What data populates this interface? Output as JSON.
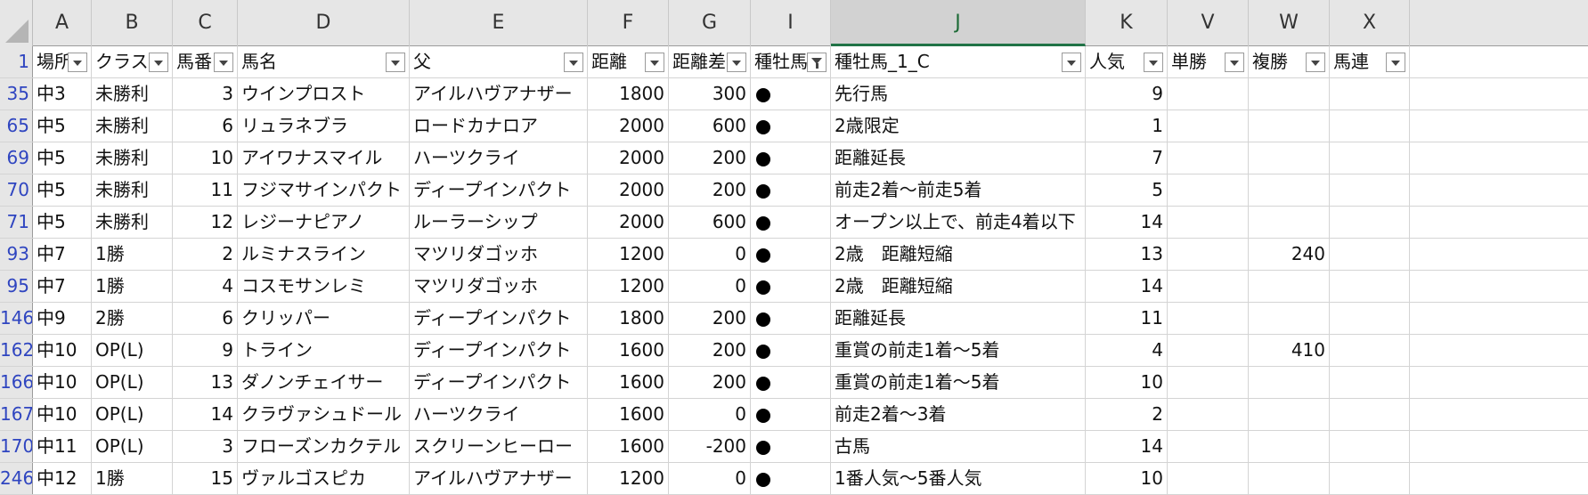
{
  "columns": [
    "A",
    "B",
    "C",
    "D",
    "E",
    "F",
    "G",
    "I",
    "J",
    "K",
    "V",
    "W",
    "X"
  ],
  "headers": [
    "場所",
    "クラス",
    "馬番",
    "馬名",
    "父",
    "距離",
    "距離差",
    "種牡馬_",
    "種牡馬_1_C",
    "人気",
    "単勝",
    "複勝",
    "馬連"
  ],
  "rows": [
    {
      "rownum": "35",
      "place": "中3",
      "cls": "未勝利",
      "umaban": "3",
      "name": "ウインプロスト",
      "sire": "アイルハヴアナザー",
      "dist": "1800",
      "diff": "300",
      "mark": "●",
      "cond": "先行馬",
      "pop": "9",
      "win": "",
      "place_pay": "",
      "quinella": ""
    },
    {
      "rownum": "65",
      "place": "中5",
      "cls": "未勝利",
      "umaban": "6",
      "name": "リュラネブラ",
      "sire": "ロードカナロア",
      "dist": "2000",
      "diff": "600",
      "mark": "●",
      "cond": "2歳限定",
      "pop": "1",
      "win": "",
      "place_pay": "",
      "quinella": ""
    },
    {
      "rownum": "69",
      "place": "中5",
      "cls": "未勝利",
      "umaban": "10",
      "name": "アイワナスマイル",
      "sire": "ハーツクライ",
      "dist": "2000",
      "diff": "200",
      "mark": "●",
      "cond": "距離延長",
      "pop": "7",
      "win": "",
      "place_pay": "",
      "quinella": ""
    },
    {
      "rownum": "70",
      "place": "中5",
      "cls": "未勝利",
      "umaban": "11",
      "name": "フジマサインパクト",
      "sire": "ディープインパクト",
      "dist": "2000",
      "diff": "200",
      "mark": "●",
      "cond": "前走2着～前走5着",
      "pop": "5",
      "win": "",
      "place_pay": "",
      "quinella": ""
    },
    {
      "rownum": "71",
      "place": "中5",
      "cls": "未勝利",
      "umaban": "12",
      "name": "レジーナピアノ",
      "sire": "ルーラーシップ",
      "dist": "2000",
      "diff": "600",
      "mark": "●",
      "cond": "オープン以上で、前走4着以下",
      "pop": "14",
      "win": "",
      "place_pay": "",
      "quinella": ""
    },
    {
      "rownum": "93",
      "place": "中7",
      "cls": "1勝",
      "umaban": "2",
      "name": "ルミナスライン",
      "sire": "マツリダゴッホ",
      "dist": "1200",
      "diff": "0",
      "mark": "●",
      "cond": "2歳　距離短縮",
      "pop": "13",
      "win": "",
      "place_pay": "240",
      "quinella": ""
    },
    {
      "rownum": "95",
      "place": "中7",
      "cls": "1勝",
      "umaban": "4",
      "name": "コスモサンレミ",
      "sire": "マツリダゴッホ",
      "dist": "1200",
      "diff": "0",
      "mark": "●",
      "cond": "2歳　距離短縮",
      "pop": "14",
      "win": "",
      "place_pay": "",
      "quinella": ""
    },
    {
      "rownum": "146",
      "place": "中9",
      "cls": "2勝",
      "umaban": "6",
      "name": "クリッパー",
      "sire": "ディープインパクト",
      "dist": "1800",
      "diff": "200",
      "mark": "●",
      "cond": "距離延長",
      "pop": "11",
      "win": "",
      "place_pay": "",
      "quinella": ""
    },
    {
      "rownum": "162",
      "place": "中10",
      "cls": "OP(L)",
      "umaban": "9",
      "name": "トライン",
      "sire": "ディープインパクト",
      "dist": "1600",
      "diff": "200",
      "mark": "●",
      "cond": "重賞の前走1着～5着",
      "pop": "4",
      "win": "",
      "place_pay": "410",
      "quinella": ""
    },
    {
      "rownum": "166",
      "place": "中10",
      "cls": "OP(L)",
      "umaban": "13",
      "name": "ダノンチェイサー",
      "sire": "ディープインパクト",
      "dist": "1600",
      "diff": "200",
      "mark": "●",
      "cond": "重賞の前走1着～5着",
      "pop": "10",
      "win": "",
      "place_pay": "",
      "quinella": ""
    },
    {
      "rownum": "167",
      "place": "中10",
      "cls": "OP(L)",
      "umaban": "14",
      "name": "クラヴァシュドール",
      "sire": "ハーツクライ",
      "dist": "1600",
      "diff": "0",
      "mark": "●",
      "cond": "前走2着～3着",
      "pop": "2",
      "win": "",
      "place_pay": "",
      "quinella": ""
    },
    {
      "rownum": "170",
      "place": "中11",
      "cls": "OP(L)",
      "umaban": "3",
      "name": "フローズンカクテル",
      "sire": "スクリーンヒーロー",
      "dist": "1600",
      "diff": "-200",
      "mark": "●",
      "cond": "古馬",
      "pop": "14",
      "win": "",
      "place_pay": "",
      "quinella": ""
    },
    {
      "rownum": "246",
      "place": "中12",
      "cls": "1勝",
      "umaban": "15",
      "name": "ヴァルゴスピカ",
      "sire": "アイルハヴアナザー",
      "dist": "1200",
      "diff": "0",
      "mark": "●",
      "cond": "1番人気～5番人気",
      "pop": "10",
      "win": "",
      "place_pay": "",
      "quinella": ""
    }
  ],
  "filter_icons": [
    "dropdown-filter-icon",
    "filter-active-icon"
  ],
  "colors": {
    "header_bg": "#e6e6e6",
    "selected_col": "#217346",
    "row_number": "#2f45c0"
  }
}
